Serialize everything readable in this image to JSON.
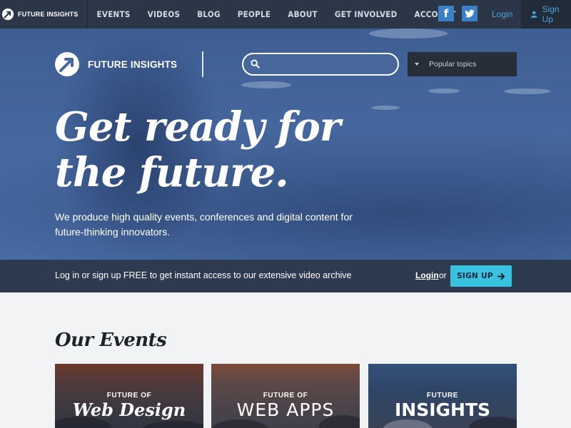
{
  "topnav": {
    "brand": "FUTURE INSIGHTS",
    "items": [
      {
        "label": "EVENTS"
      },
      {
        "label": "VIDEOS"
      },
      {
        "label": "BLOG"
      },
      {
        "label": "PEOPLE"
      },
      {
        "label": "ABOUT"
      },
      {
        "label": "GET INVOLVED"
      },
      {
        "label": "ACCOUNT"
      }
    ],
    "social": {
      "facebook": "f",
      "twitter": "t"
    },
    "login": "Login",
    "signup": "Sign Up"
  },
  "hero": {
    "brand": "FUTURE INSIGHTS",
    "search": {
      "value": "",
      "placeholder": ""
    },
    "topics": {
      "selected": "Popular topics"
    },
    "headline_line1": "Get ready for",
    "headline_line2": "the future.",
    "subtext": "We produce high quality events, conferences and digital content for future-thinking innovators."
  },
  "banner": {
    "message": "Log in or sign up FREE to get instant access to our extensive video archive",
    "login": "Login",
    "or": "or",
    "signup": "SIGN UP"
  },
  "events": {
    "title": "Our Events",
    "cards": [
      {
        "small": "FUTURE OF",
        "big": "Web Design"
      },
      {
        "small": "FUTURE OF",
        "big": "WEB APPS"
      },
      {
        "small": "FUTURE",
        "big": "INSIGHTS"
      }
    ]
  },
  "colors": {
    "nav_bg": "#2b3647",
    "hero_blue": "#46679e",
    "banner_bg": "#2e3a4f",
    "accent": "#39c2e0",
    "link_blue": "#4aa3df"
  }
}
